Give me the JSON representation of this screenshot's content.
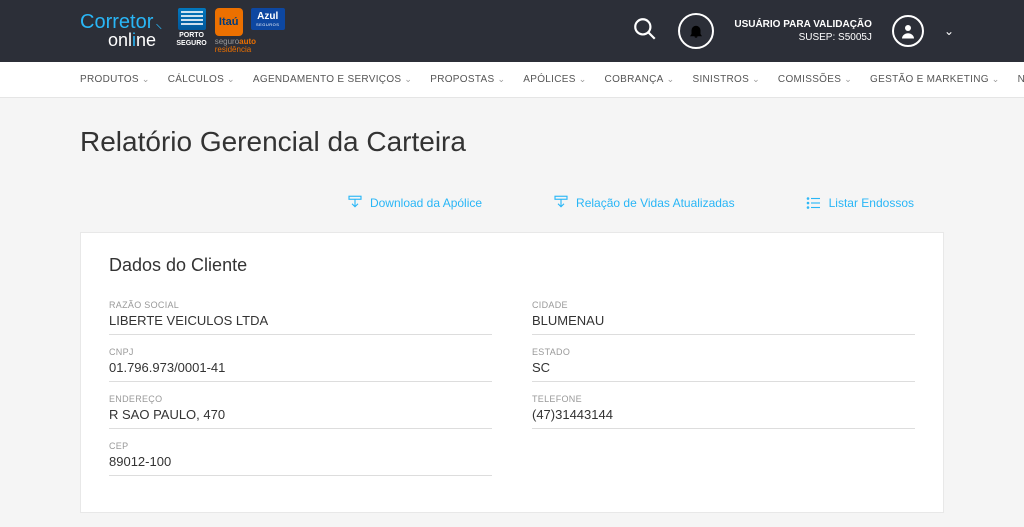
{
  "header": {
    "logo_top": "Corretor",
    "logo_bottom_pre": "onl",
    "logo_bottom_i": "i",
    "logo_bottom_post": "ne",
    "porto_line1": "PORTO",
    "porto_line2": "SEGURO",
    "itau": "Itaú",
    "azul": "Azul",
    "azul_sub": "SEGUROS",
    "auto_pre": "seguro",
    "auto_bold": "auto",
    "auto_res": "residência",
    "user_line1": "USUÁRIO PARA VALIDAÇÃO",
    "user_line2": "SUSEP: S5005J"
  },
  "nav": {
    "items": [
      "PRODUTOS",
      "CÁLCULOS",
      "AGENDAMENTO E SERVIÇOS",
      "PROPOSTAS",
      "APÓLICES",
      "COBRANÇA",
      "SINISTROS",
      "COMISSÕES",
      "GESTÃO E MARKETING",
      "NOTÍCIAS"
    ]
  },
  "page": {
    "title": "Relatório Gerencial da Carteira"
  },
  "actions": {
    "download": "Download da Apólice",
    "relacao": "Relação de Vidas Atualizadas",
    "listar": "Listar Endossos"
  },
  "client": {
    "section_title": "Dados do Cliente",
    "labels": {
      "razao": "RAZÃO SOCIAL",
      "cnpj": "CNPJ",
      "endereco": "ENDEREÇO",
      "cep": "CEP",
      "cidade": "CIDADE",
      "estado": "ESTADO",
      "telefone": "TELEFONE"
    },
    "values": {
      "razao": "LIBERTE VEICULOS LTDA",
      "cnpj": "01.796.973/0001-41",
      "endereco": "R SAO PAULO, 470",
      "cep": "89012-100",
      "cidade": "BLUMENAU",
      "estado": "SC",
      "telefone": "(47)31443144"
    }
  }
}
